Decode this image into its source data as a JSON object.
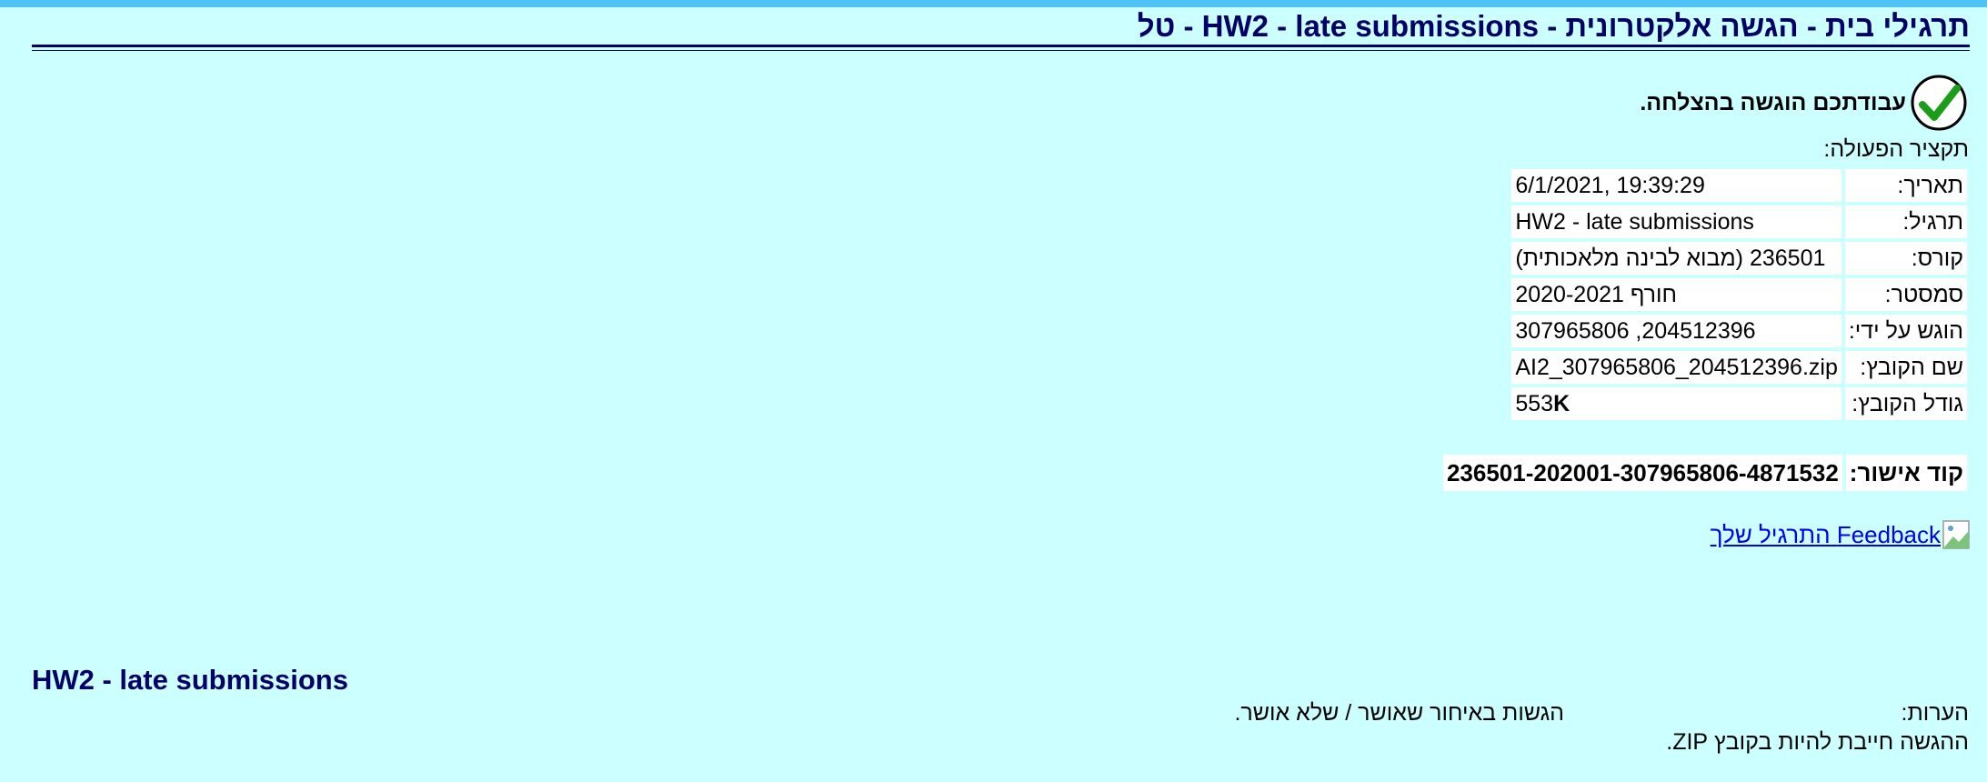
{
  "header": {
    "title": "תרגילי בית - הגשה אלקטרונית - HW2 - late submissions - טל"
  },
  "status": {
    "message": "עבודתכם הוגשה בהצלחה.",
    "icon": "checkmark-icon",
    "accent_color": "#1a9e1a"
  },
  "summary": {
    "label": "תקציר הפעולה:",
    "rows": [
      {
        "label": "תאריך:",
        "value": "6/1/2021, 19:39:29"
      },
      {
        "label": "תרגיל:",
        "value": "HW2 - late submissions"
      },
      {
        "label": "קורס:",
        "value": "236501 (מבוא לבינה מלאכותית)"
      },
      {
        "label": "סמסטר:",
        "value": "חורף 2020-2021"
      },
      {
        "label": "הוגש על ידי:",
        "value": "204512396, 307965806"
      },
      {
        "label": "שם הקובץ:",
        "value": "AI2_307965806_204512396.zip"
      },
      {
        "label": "גודל הקובץ:",
        "value_number": "553",
        "value_unit": "K"
      }
    ]
  },
  "approval": {
    "label": "קוד אישור:",
    "code": "236501-202001-307965806-4871532"
  },
  "feedback": {
    "link_text": "Feedback התרגיל שלך",
    "icon": "broken-image-icon"
  },
  "assignment": {
    "title": "HW2 - late submissions",
    "notes_label": "הערות:",
    "notes_value": "הגשות באיחור שאושר / שלא אושר.",
    "notes_line2": "ההגשה חייבת להיות בקובץ ZIP."
  }
}
